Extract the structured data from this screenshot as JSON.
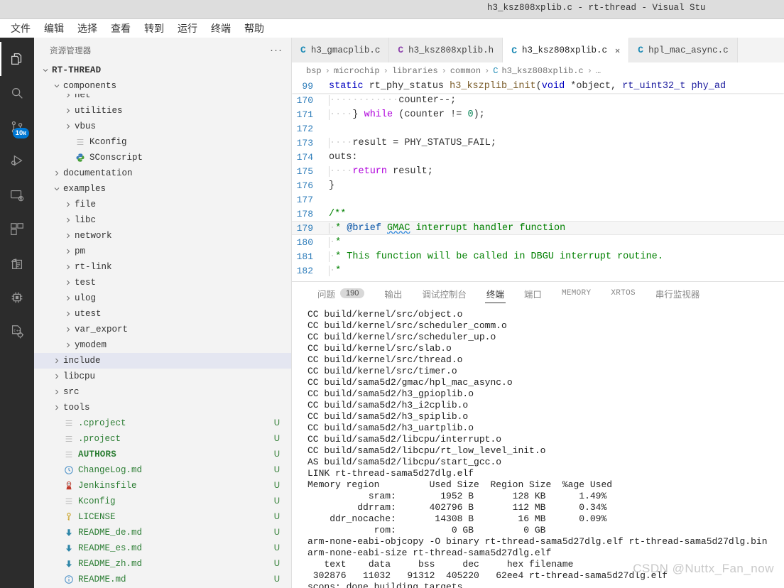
{
  "window": {
    "title": "h3_ksz808xplib.c - rt-thread - Visual Stu"
  },
  "menubar": {
    "items": [
      "文件",
      "编辑",
      "选择",
      "查看",
      "转到",
      "运行",
      "终端",
      "帮助"
    ]
  },
  "activitybar": {
    "items": [
      {
        "name": "explorer",
        "icon": "files-icon",
        "badge": ""
      },
      {
        "name": "search",
        "icon": "search-icon",
        "badge": ""
      },
      {
        "name": "source-control",
        "icon": "source-control-icon",
        "badge": "10к"
      },
      {
        "name": "run-and-debug",
        "icon": "run-debug-icon",
        "badge": ""
      },
      {
        "name": "remote-explorer",
        "icon": "remote-explorer-icon",
        "badge": ""
      },
      {
        "name": "extensions",
        "icon": "extensions-icon",
        "badge": ""
      },
      {
        "name": "import-project",
        "icon": "import-project-icon",
        "badge": ""
      },
      {
        "name": "embedded",
        "icon": "chip-icon",
        "badge": ""
      },
      {
        "name": "cpp-config",
        "icon": "cpp-config-icon",
        "badge": ""
      }
    ]
  },
  "sidebar": {
    "header": "资源管理器",
    "more_label": "···",
    "root": "RT-THREAD",
    "items": [
      {
        "label": "components",
        "type": "folder",
        "expanded": true,
        "indent": 1,
        "sticky": true,
        "git": ""
      },
      {
        "label": "net",
        "type": "folder",
        "expanded": false,
        "indent": 2,
        "clipped": true,
        "git": ""
      },
      {
        "label": "utilities",
        "type": "folder",
        "expanded": false,
        "indent": 2,
        "git": ""
      },
      {
        "label": "vbus",
        "type": "folder",
        "expanded": false,
        "indent": 2,
        "git": ""
      },
      {
        "label": "Kconfig",
        "type": "file",
        "icon": "text-file-icon",
        "indent": 2,
        "git": ""
      },
      {
        "label": "SConscript",
        "type": "file",
        "icon": "python-file-icon",
        "indent": 2,
        "git": ""
      },
      {
        "label": "documentation",
        "type": "folder",
        "expanded": false,
        "indent": 1,
        "git": ""
      },
      {
        "label": "examples",
        "type": "folder",
        "expanded": true,
        "indent": 1,
        "git": ""
      },
      {
        "label": "file",
        "type": "folder",
        "expanded": false,
        "indent": 2,
        "git": ""
      },
      {
        "label": "libc",
        "type": "folder",
        "expanded": false,
        "indent": 2,
        "git": ""
      },
      {
        "label": "network",
        "type": "folder",
        "expanded": false,
        "indent": 2,
        "git": ""
      },
      {
        "label": "pm",
        "type": "folder",
        "expanded": false,
        "indent": 2,
        "git": ""
      },
      {
        "label": "rt-link",
        "type": "folder",
        "expanded": false,
        "indent": 2,
        "git": ""
      },
      {
        "label": "test",
        "type": "folder",
        "expanded": false,
        "indent": 2,
        "git": ""
      },
      {
        "label": "ulog",
        "type": "folder",
        "expanded": false,
        "indent": 2,
        "git": ""
      },
      {
        "label": "utest",
        "type": "folder",
        "expanded": false,
        "indent": 2,
        "git": ""
      },
      {
        "label": "var_export",
        "type": "folder",
        "expanded": false,
        "indent": 2,
        "git": ""
      },
      {
        "label": "ymodem",
        "type": "folder",
        "expanded": false,
        "indent": 2,
        "git": ""
      },
      {
        "label": "include",
        "type": "folder",
        "expanded": false,
        "indent": 1,
        "selected": true,
        "git": ""
      },
      {
        "label": "libcpu",
        "type": "folder",
        "expanded": false,
        "indent": 1,
        "git": ""
      },
      {
        "label": "src",
        "type": "folder",
        "expanded": false,
        "indent": 1,
        "git": ""
      },
      {
        "label": "tools",
        "type": "folder",
        "expanded": false,
        "indent": 1,
        "git": ""
      },
      {
        "label": ".cproject",
        "type": "file",
        "icon": "text-file-icon",
        "indent": 1,
        "git": "U",
        "green": true
      },
      {
        "label": ".project",
        "type": "file",
        "icon": "text-file-icon",
        "indent": 1,
        "git": "U",
        "green": true
      },
      {
        "label": "AUTHORS",
        "type": "file",
        "icon": "text-file-icon",
        "indent": 1,
        "git": "U",
        "green": true,
        "bold": true
      },
      {
        "label": "ChangeLog.md",
        "type": "file",
        "icon": "clock-icon",
        "indent": 1,
        "git": "U",
        "green": true
      },
      {
        "label": "Jenkinsfile",
        "type": "file",
        "icon": "jenkins-icon",
        "indent": 1,
        "git": "U",
        "green": true
      },
      {
        "label": "Kconfig",
        "type": "file",
        "icon": "text-file-icon",
        "indent": 1,
        "git": "U",
        "green": true
      },
      {
        "label": "LICENSE",
        "type": "file",
        "icon": "key-icon",
        "indent": 1,
        "git": "U",
        "green": true
      },
      {
        "label": "README_de.md",
        "type": "file",
        "icon": "markdown-icon",
        "indent": 1,
        "git": "U",
        "green": true
      },
      {
        "label": "README_es.md",
        "type": "file",
        "icon": "markdown-icon",
        "indent": 1,
        "git": "U",
        "green": true
      },
      {
        "label": "README_zh.md",
        "type": "file",
        "icon": "markdown-icon",
        "indent": 1,
        "git": "U",
        "green": true
      },
      {
        "label": "README.md",
        "type": "file",
        "icon": "info-icon",
        "indent": 1,
        "git": "U",
        "green": true
      }
    ]
  },
  "editor": {
    "tabs": [
      {
        "label": "h3_gmacplib.c",
        "icon": "c-file-icon",
        "icon_color": "blue",
        "active": false,
        "closable": false
      },
      {
        "label": "h3_ksz808xplib.h",
        "icon": "c-header-icon",
        "icon_color": "purple",
        "active": false,
        "closable": false
      },
      {
        "label": "h3_ksz808xplib.c",
        "icon": "c-file-icon",
        "icon_color": "blue",
        "active": true,
        "closable": true,
        "close_label": "✕"
      },
      {
        "label": "hpl_mac_async.c",
        "icon": "c-file-icon",
        "icon_color": "blue",
        "active": false,
        "closable": false
      }
    ],
    "breadcrumb": [
      "bsp",
      "microchip",
      "libraries",
      "common",
      "h3_ksz808xplib.c",
      "…"
    ],
    "breadcrumb_separator": "›",
    "breadcrumb_file_icon": "c-file-icon",
    "lines": [
      {
        "num": "99",
        "sticky": true,
        "text": "static rt_phy_status h3_kszplib_init(void *object, rt_uint32_t phy_ad"
      },
      {
        "num": "170",
        "text": "            counter--;"
      },
      {
        "num": "171",
        "text": "    } while (counter != 0);"
      },
      {
        "num": "172",
        "text": ""
      },
      {
        "num": "173",
        "text": "    result = PHY_STATUS_FAIL;"
      },
      {
        "num": "174",
        "text": "outs:"
      },
      {
        "num": "175",
        "text": "    return result;"
      },
      {
        "num": "176",
        "text": "}"
      },
      {
        "num": "177",
        "text": ""
      },
      {
        "num": "178",
        "text": "/**"
      },
      {
        "num": "179",
        "text": " * @brief GMAC interrupt handler function",
        "current": true
      },
      {
        "num": "180",
        "text": " *"
      },
      {
        "num": "181",
        "text": " * This function will be called in DBGU interrupt routine."
      },
      {
        "num": "182",
        "text": " *"
      }
    ]
  },
  "panel": {
    "tabs": [
      {
        "label": "问题",
        "badge": "190",
        "active": false,
        "mono": false
      },
      {
        "label": "输出",
        "badge": "",
        "active": false,
        "mono": false
      },
      {
        "label": "调试控制台",
        "badge": "",
        "active": false,
        "mono": false
      },
      {
        "label": "终端",
        "badge": "",
        "active": true,
        "mono": false
      },
      {
        "label": "端口",
        "badge": "",
        "active": false,
        "mono": false
      },
      {
        "label": "MEMORY",
        "badge": "",
        "active": false,
        "mono": true
      },
      {
        "label": "XRTOS",
        "badge": "",
        "active": false,
        "mono": true
      },
      {
        "label": "串行监视器",
        "badge": "",
        "active": false,
        "mono": false
      }
    ],
    "terminal_lines": [
      "CC build/kernel/src/object.o",
      "CC build/kernel/src/scheduler_comm.o",
      "CC build/kernel/src/scheduler_up.o",
      "CC build/kernel/src/slab.o",
      "CC build/kernel/src/thread.o",
      "CC build/kernel/src/timer.o",
      "CC build/sama5d2/gmac/hpl_mac_async.o",
      "CC build/sama5d2/h3_gpioplib.o",
      "CC build/sama5d2/h3_i2cplib.o",
      "CC build/sama5d2/h3_spiplib.o",
      "CC build/sama5d2/h3_uartplib.o",
      "CC build/sama5d2/libcpu/interrupt.o",
      "CC build/sama5d2/libcpu/rt_low_level_init.o",
      "AS build/sama5d2/libcpu/start_gcc.o",
      "LINK rt-thread-sama5d27dlg.elf",
      "Memory region         Used Size  Region Size  %age Used",
      "           sram:        1952 B       128 KB      1.49%",
      "         ddrram:      402796 B       112 MB      0.34%",
      "    ddr_nocache:       14308 B        16 MB      0.09%",
      "            rom:          0 GB         0 GB",
      "arm-none-eabi-objcopy -O binary rt-thread-sama5d27dlg.elf rt-thread-sama5d27dlg.bin",
      "arm-none-eabi-size rt-thread-sama5d27dlg.elf",
      "   text    data     bss     dec     hex filename",
      " 302876   11032   91312  405220   62ee4 rt-thread-sama5d27dlg.elf",
      "scons: done building targets."
    ],
    "watermark": "CSDN @Nuttx_Fan_now"
  },
  "colors": {
    "accent": "#0078d4",
    "git_untracked": "#2b7d33",
    "activitybar_bg": "#2c2c2c",
    "sidebar_bg": "#f3f3f3",
    "selected_row": "#e4e6f1"
  }
}
